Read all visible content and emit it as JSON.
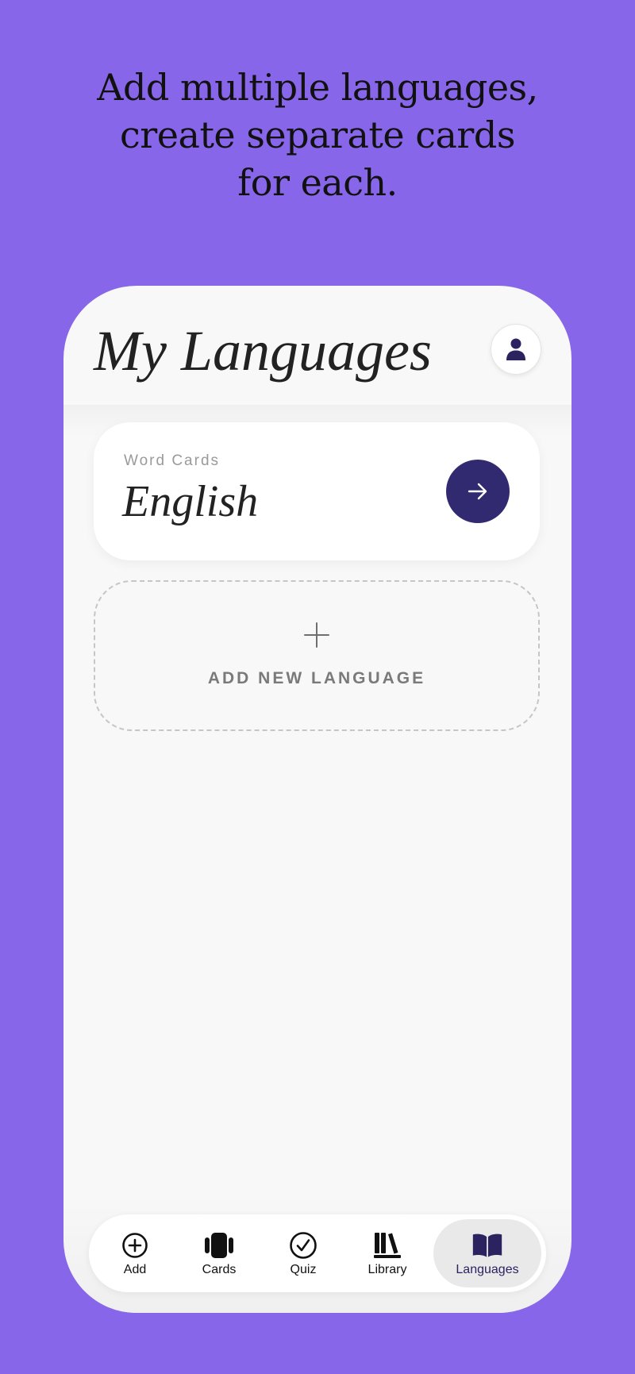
{
  "headline": {
    "line1": "Add multiple languages,",
    "line2": "create separate cards",
    "line3": "for each."
  },
  "screen": {
    "title": "My Languages",
    "profile_icon": "person-icon"
  },
  "language_card": {
    "kicker": "Word Cards",
    "language": "English",
    "action_icon": "arrow-right-icon"
  },
  "add_language": {
    "icon": "plus-icon",
    "label": "ADD NEW LANGUAGE"
  },
  "tab_bar": {
    "tabs": [
      {
        "label": "Add",
        "icon": "plus-circle-icon"
      },
      {
        "label": "Cards",
        "icon": "cards-icon"
      },
      {
        "label": "Quiz",
        "icon": "check-circle-icon"
      },
      {
        "label": "Library",
        "icon": "library-icon"
      },
      {
        "label": "Languages",
        "icon": "open-book-icon",
        "active": true
      }
    ]
  },
  "colors": {
    "background": "#8766E9",
    "accent": "#312A70",
    "surface": "#F8F8F8"
  }
}
